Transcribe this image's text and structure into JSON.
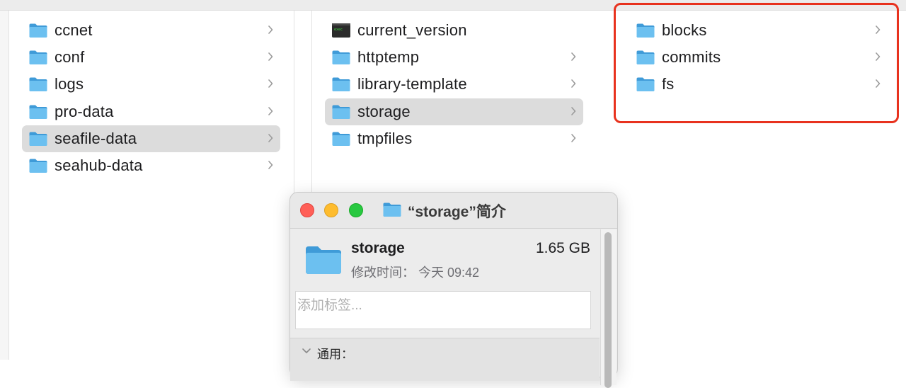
{
  "col1": {
    "items": [
      {
        "label": "ccnet"
      },
      {
        "label": "conf"
      },
      {
        "label": "logs"
      },
      {
        "label": "pro-data"
      },
      {
        "label": "seafile-data"
      },
      {
        "label": "seahub-data"
      }
    ]
  },
  "col2": {
    "items": [
      {
        "label": "current_version"
      },
      {
        "label": "httptemp"
      },
      {
        "label": "library-template"
      },
      {
        "label": "storage"
      },
      {
        "label": "tmpfiles"
      }
    ]
  },
  "col3": {
    "items": [
      {
        "label": "blocks"
      },
      {
        "label": "commits"
      },
      {
        "label": "fs"
      }
    ]
  },
  "info": {
    "title": "“storage”简介",
    "name": "storage",
    "size": "1.65 GB",
    "modified": "修改时间： 今天 09:42",
    "tag_placeholder": "添加标签...",
    "section_general": "通用："
  },
  "colors": {
    "selection": "#dcdcdc",
    "folder": "#5ab0e6",
    "highlight_border": "#e8321e"
  }
}
